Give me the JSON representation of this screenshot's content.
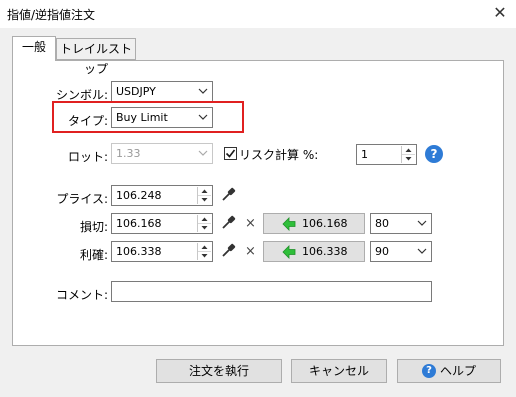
{
  "window": {
    "title": "指値/逆指値注文",
    "close_glyph": "✕"
  },
  "tabs": [
    {
      "label": "一般",
      "selected": true
    },
    {
      "label": "トレイルストップ",
      "selected": false
    }
  ],
  "form": {
    "symbol": {
      "label": "シンボル:",
      "value": "USDJPY"
    },
    "type": {
      "label": "タイプ:",
      "value": "Buy Limit"
    },
    "lot": {
      "label": "ロット:",
      "value": "1.33",
      "disabled": true
    },
    "risk": {
      "checkbox_label": "リスク計算 %:",
      "checked": true,
      "value": "1"
    },
    "price": {
      "label": "プライス:",
      "value": "106.248"
    },
    "stop_loss": {
      "label": "損切:",
      "value": "106.168",
      "button_value": "106.168",
      "points": "80"
    },
    "take_profit": {
      "label": "利確:",
      "value": "106.338",
      "button_value": "106.338",
      "points": "90"
    },
    "comment": {
      "label": "コメント:",
      "value": ""
    }
  },
  "buttons": {
    "execute": "注文を執行",
    "cancel": "キャンセル",
    "help": "ヘルプ"
  },
  "colors": {
    "highlight": "#e02020",
    "help_icon": "#2e7bd6",
    "arrow_green": "#2fbf3a"
  },
  "icons": {
    "pipette": "eyedropper-icon",
    "x": "×",
    "question": "?"
  }
}
